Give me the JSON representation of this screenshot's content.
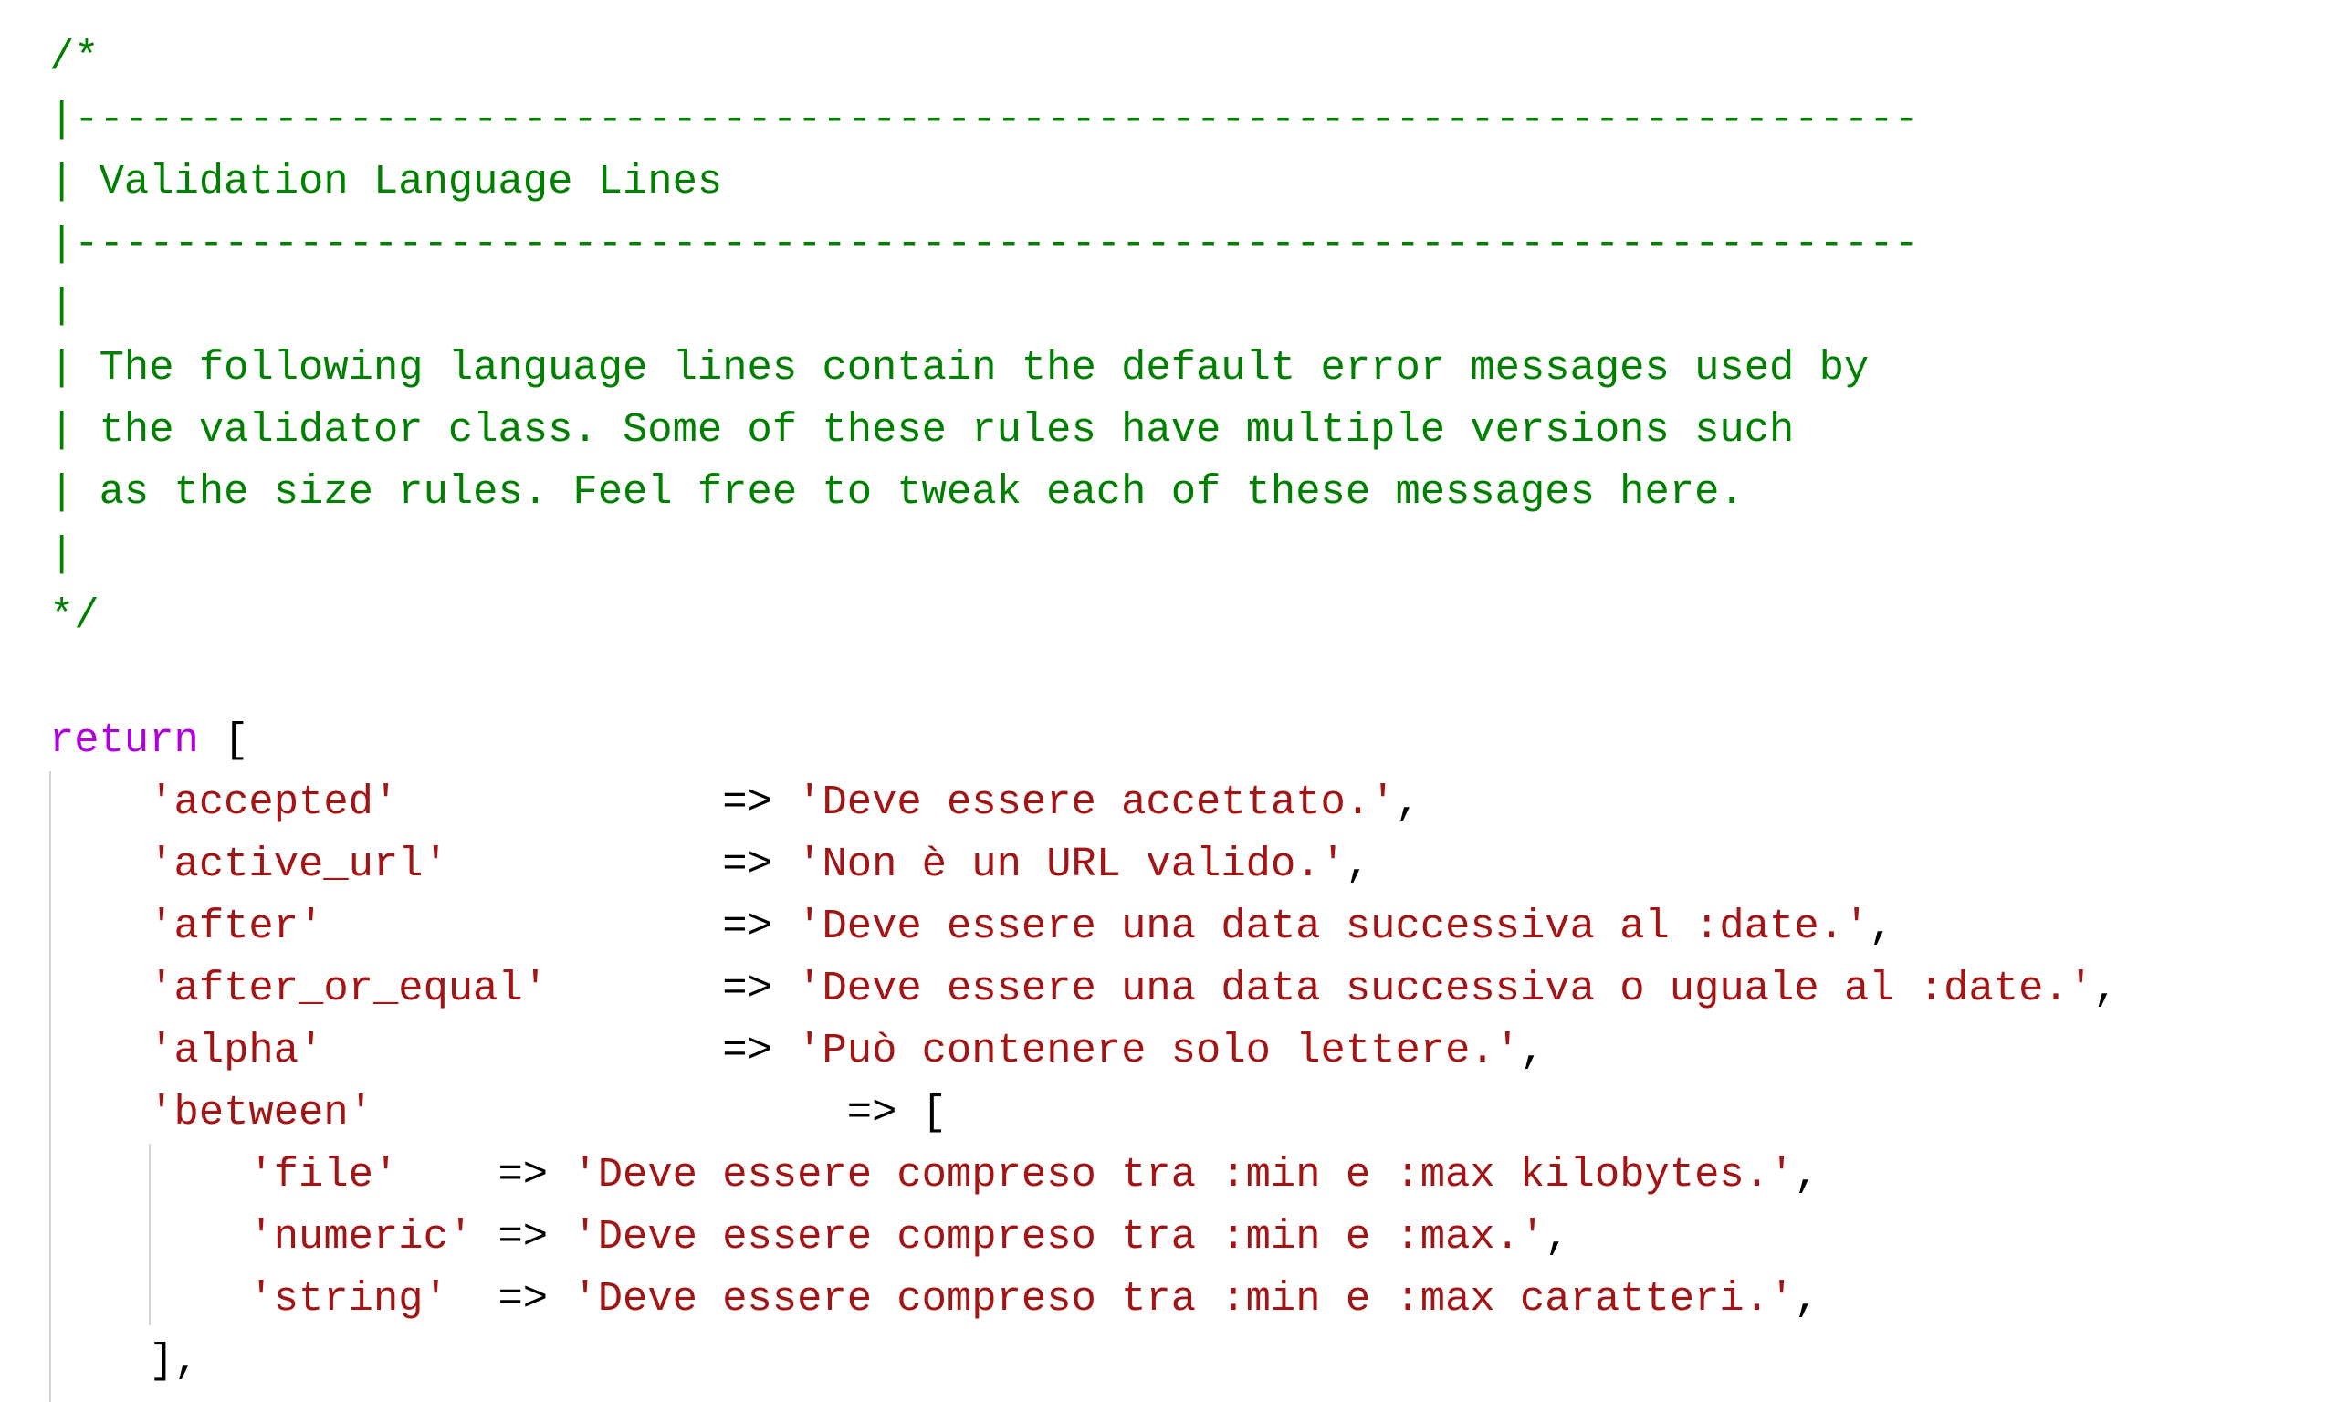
{
  "editor": {
    "theme_colors": {
      "comment": "#008000",
      "keyword": "#AF00DB",
      "string": "#A31515",
      "punctuation": "#000000",
      "indent_guide": "#D4D4D4",
      "background": "#FFFFFF"
    },
    "comment_block": {
      "open": "/*",
      "rule": "|--------------------------------------------------------------------------",
      "title": "| Validation Language Lines",
      "bar": "|",
      "description": [
        "| The following language lines contain the default error messages used by",
        "| the validator class. Some of these rules have multiple versions such",
        "| as the size rules. Feel free to tweak each of these messages here."
      ],
      "close": "*/"
    },
    "return_statement": {
      "keyword": "return",
      "open_bracket": "["
    },
    "arrow": "=>",
    "comma": ",",
    "entries": [
      {
        "key": "'accepted'",
        "value": "'Deve essere accettato.'"
      },
      {
        "key": "'active_url'",
        "value": "'Non è un URL valido.'"
      },
      {
        "key": "'after'",
        "value": "'Deve essere una data successiva al :date.'"
      },
      {
        "key": "'after_or_equal'",
        "value": "'Deve essere una data successiva o uguale al :date.'"
      },
      {
        "key": "'alpha'",
        "value": "'Può contenere solo lettere.'"
      }
    ],
    "nested_entry": {
      "key": "'between'",
      "open_bracket": "[",
      "children": [
        {
          "key": "'file'",
          "value": "'Deve essere compreso tra :min e :max kilobytes.'"
        },
        {
          "key": "'numeric'",
          "value": "'Deve essere compreso tra :min e :max.'"
        },
        {
          "key": "'string'",
          "value": "'Deve essere compreso tra :min e :max caratteri.'"
        }
      ],
      "close": "],"
    }
  }
}
